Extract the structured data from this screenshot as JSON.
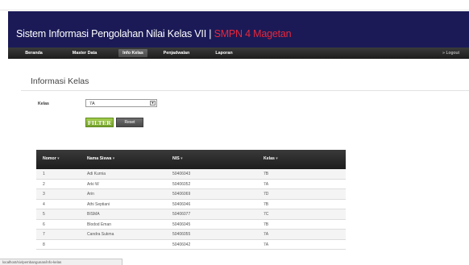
{
  "header": {
    "title": "Sistem Informasi Pengolahan Nilai Kelas VII | ",
    "school": "SMPN 4 Magetan"
  },
  "nav": {
    "items": [
      "Beranda",
      "Master Data",
      "Info Kelas",
      "Penjadwalan",
      "Laporan"
    ],
    "active": "Info Kelas",
    "logout": "» Logout"
  },
  "page": {
    "title": "Informasi Kelas"
  },
  "filter": {
    "label": "Kelas",
    "selected": "7A",
    "filter_label": "FILTER",
    "reset_label": "Reset"
  },
  "table": {
    "headers": [
      "Nomor",
      "Nama Siswa",
      "NIS",
      "Kelas"
    ],
    "sort_glyph": "▾",
    "rows": [
      [
        "1",
        "Adi Kurnia",
        "50406043",
        "7B"
      ],
      [
        "2",
        "Arki W",
        "50406052",
        "7A"
      ],
      [
        "3",
        "Arin",
        "50406069",
        "7D"
      ],
      [
        "4",
        "Athi Septiani",
        "50406046",
        "7B"
      ],
      [
        "5",
        "BISMA",
        "50406077",
        "7C"
      ],
      [
        "6",
        "Blodod Eman",
        "50406045",
        "7B"
      ],
      [
        "7",
        "Candra Sukma",
        "50406055",
        "7A"
      ],
      [
        "8",
        "",
        "50406042",
        "7A"
      ]
    ]
  },
  "status": {
    "text": "localhost/siv/pembangunan/info-kelas"
  }
}
